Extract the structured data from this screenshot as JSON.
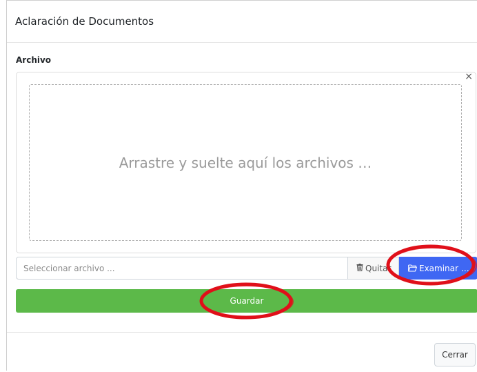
{
  "modal": {
    "title": "Aclaración de Documentos"
  },
  "form": {
    "file_label": "Archivo",
    "close_preview_symbol": "×",
    "drop_zone_text": "Arrastre y suelte aquí los archivos …",
    "caption_placeholder": "Seleccionar archivo ...",
    "remove_label": "Quitar",
    "browse_label": "Examinar …",
    "save_label": "Guardar"
  },
  "footer": {
    "close_label": "Cerrar"
  },
  "icons": {
    "remove": "trash-icon",
    "browse": "folder-open-icon"
  },
  "colors": {
    "browse_button": "#3f67f3",
    "save_button": "#5cb949",
    "annotation_circles": "#e0101a"
  }
}
